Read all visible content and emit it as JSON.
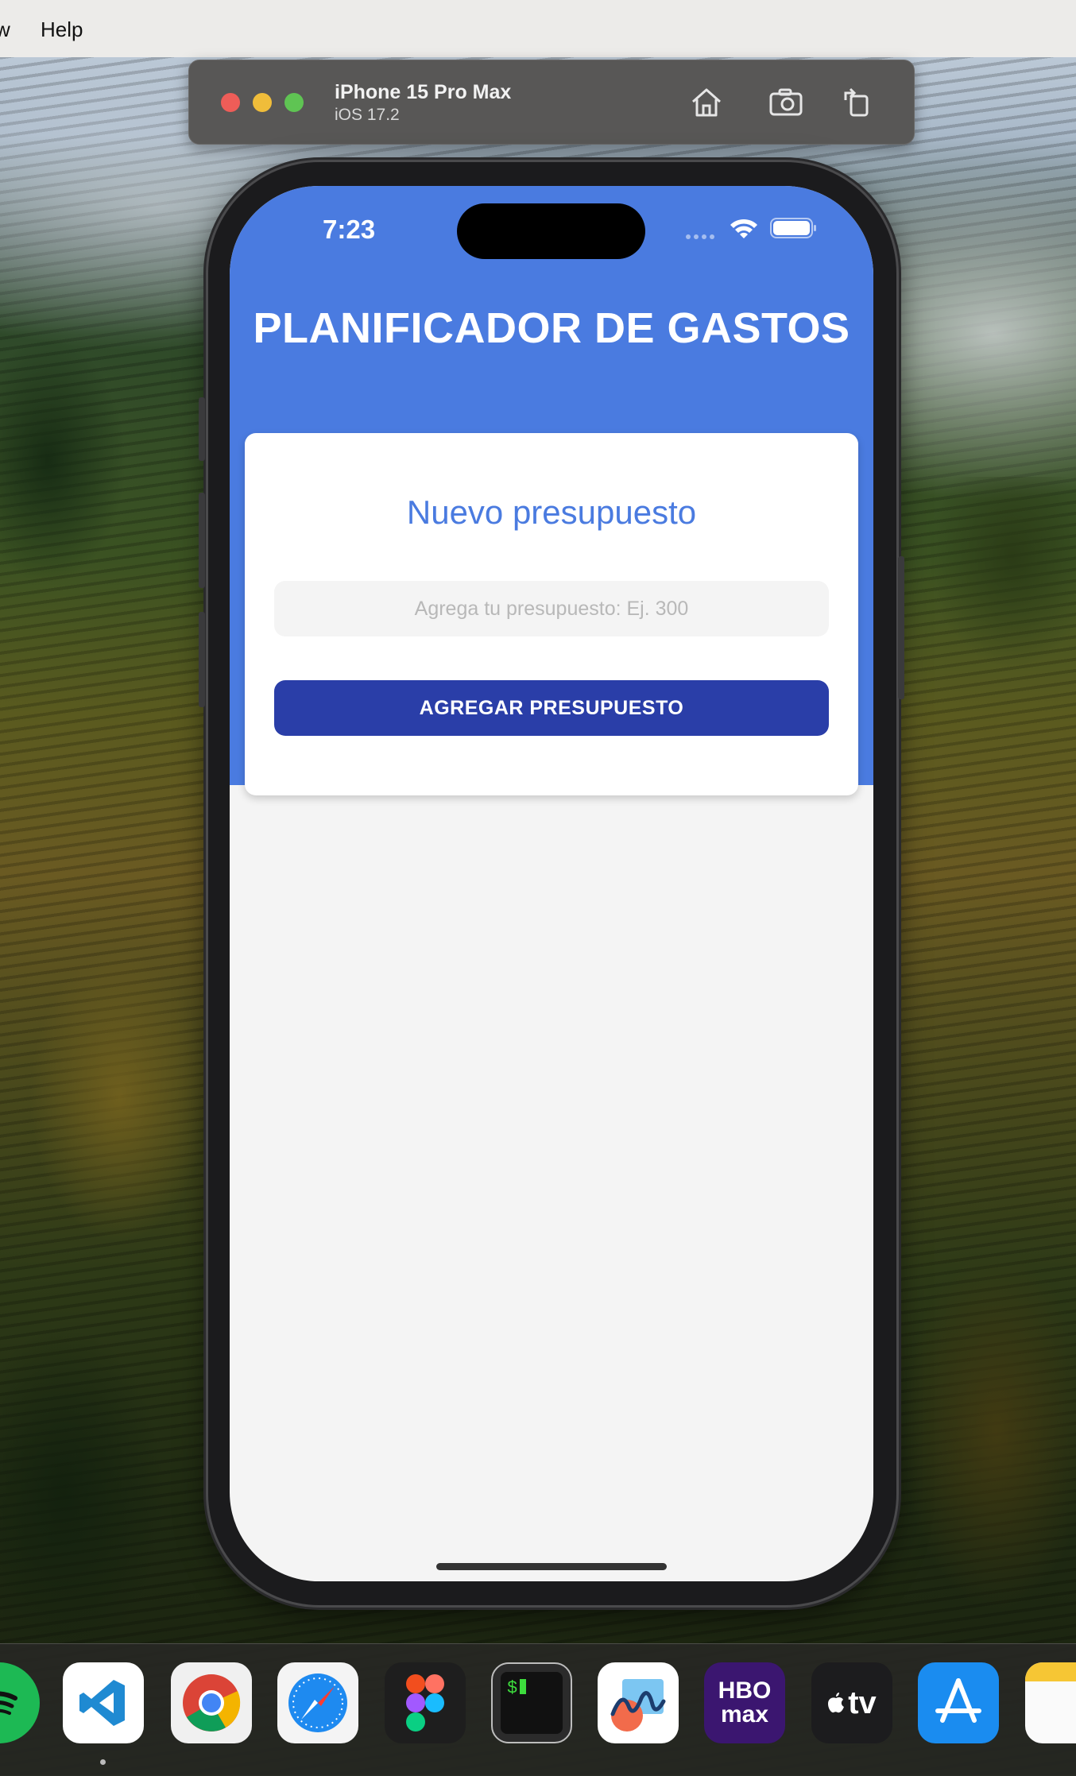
{
  "menubar": {
    "items": [
      "w",
      "Help"
    ]
  },
  "simulator": {
    "device_name": "iPhone 15 Pro Max",
    "os_version": "iOS 17.2",
    "controls": [
      "home-icon",
      "screenshot-icon",
      "rotate-icon"
    ]
  },
  "status_bar": {
    "time": "7:23"
  },
  "app": {
    "title": "PLANIFICADOR DE GASTOS",
    "card_title": "Nuevo presupuesto",
    "input_placeholder": "Agrega tu presupuesto: Ej. 300",
    "input_value": "",
    "submit_label": "AGREGAR PRESUPUESTO"
  },
  "dock": {
    "apps": [
      "spotify-icon",
      "vscode-icon",
      "chrome-icon",
      "safari-icon",
      "figma-icon",
      "terminal-icon",
      "freeform-icon",
      "hbo-max-icon",
      "apple-tv-icon",
      "app-store-icon",
      "notes-icon"
    ],
    "hbo_label": "HBO max",
    "tv_label": "tv"
  },
  "colors": {
    "header_blue": "#4a7be0",
    "button_blue": "#2a3ea8",
    "screen_bg": "#f4f4f4"
  }
}
